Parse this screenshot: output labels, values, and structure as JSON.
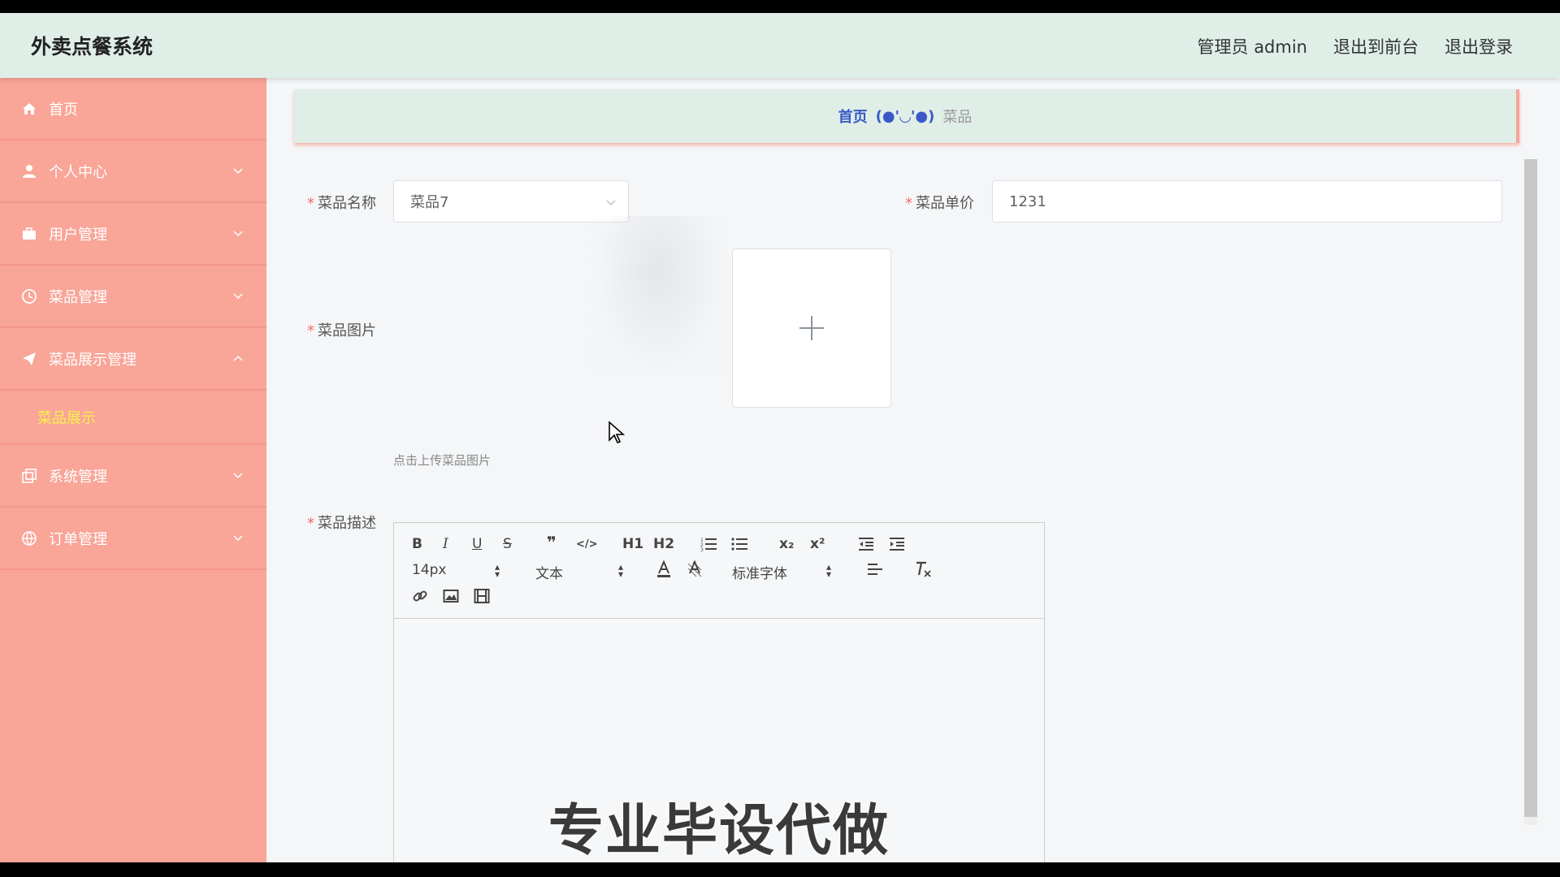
{
  "app": {
    "title": "外卖点餐系统"
  },
  "header": {
    "links": [
      "管理员 admin",
      "退出到前台",
      "退出登录"
    ]
  },
  "sidebar": {
    "items": [
      {
        "label": "首页",
        "icon": "home-icon"
      },
      {
        "label": "个人中心",
        "icon": "user-icon"
      },
      {
        "label": "用户管理",
        "icon": "briefcase-icon"
      },
      {
        "label": "菜品管理",
        "icon": "clock-icon"
      },
      {
        "label": "菜品展示管理",
        "icon": "paper-plane-icon"
      },
      {
        "label": "系统管理",
        "icon": "copy-icon"
      },
      {
        "label": "订单管理",
        "icon": "globe-icon"
      }
    ],
    "submenu_active": "菜品展示"
  },
  "breadcrumb": {
    "home": "首页",
    "separator": "(●'◡'●)",
    "current": "菜品"
  },
  "form": {
    "name_label": "菜品名称",
    "name_value": "菜品7",
    "price_label": "菜品单价",
    "price_value": "1231",
    "image_label": "菜品图片",
    "image_hint": "点击上传菜品图片",
    "desc_label": "菜品描述"
  },
  "editor": {
    "font_size": "14px",
    "header_select": "文本",
    "font_family": "标准字体",
    "toolbar_text": {
      "h1": "H1",
      "h2": "H2",
      "sub": "x₂",
      "sup": "x²",
      "bold": "B",
      "italic": "I",
      "underline": "U",
      "strike": "S",
      "quote": "❞",
      "code": "</>"
    }
  },
  "overlay": {
    "watermark": "专业毕设代做"
  },
  "colors": {
    "header_bg": "#dfeee7",
    "sidebar_bg": "#f9a598",
    "active_submenu": "#f7f24a",
    "breadcrumb_link": "#3a58c8",
    "required": "#f56c6c"
  }
}
